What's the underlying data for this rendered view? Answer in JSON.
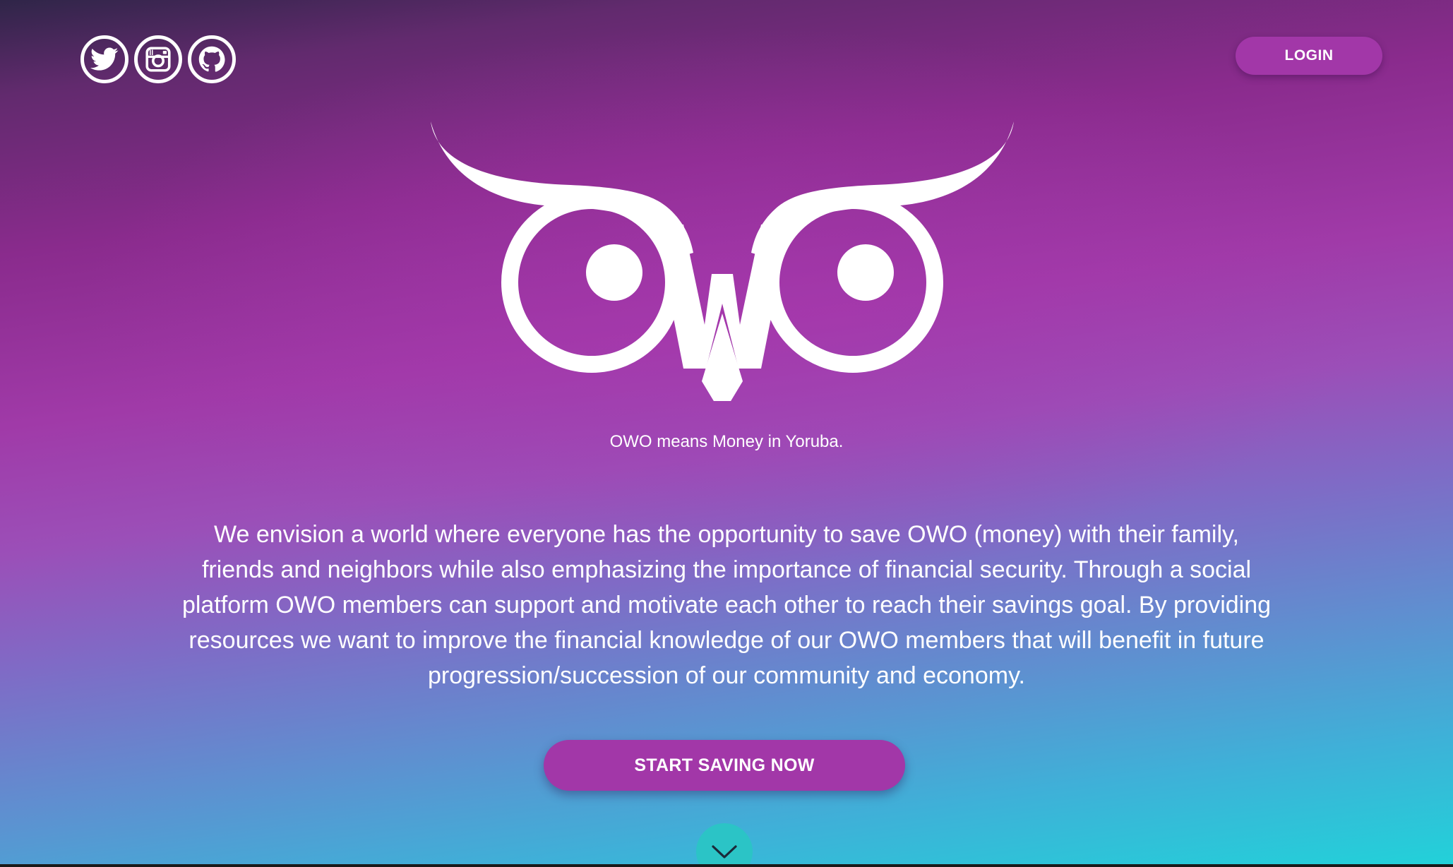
{
  "header": {
    "social_links": [
      {
        "name": "twitter",
        "icon": "twitter-icon"
      },
      {
        "name": "instagram",
        "icon": "instagram-icon"
      },
      {
        "name": "github",
        "icon": "github-icon"
      }
    ],
    "login_label": "LOGIN"
  },
  "hero": {
    "logo_icon": "owl-logo-icon",
    "tagline": "OWO means Money in Yoruba.",
    "mission": "We envision a world where everyone has the opportunity to save OWO (money) with their family, friends and neighbors while also emphasizing the importance of financial security. Through a social platform OWO members can support and motivate each other to reach their savings goal. By providing resources we want to improve the financial knowledge of our OWO members that will benefit in future progression/succession of our community and economy.",
    "cta_label": "START SAVING NOW",
    "scroll_icon": "chevron-down-icon"
  },
  "colors": {
    "button_purple": "#a237a8",
    "gradient_top": "#2f2548",
    "gradient_mid": "#a03aa8",
    "gradient_bottom": "#22d1d9",
    "scroll_button": "#2bc4c6"
  }
}
